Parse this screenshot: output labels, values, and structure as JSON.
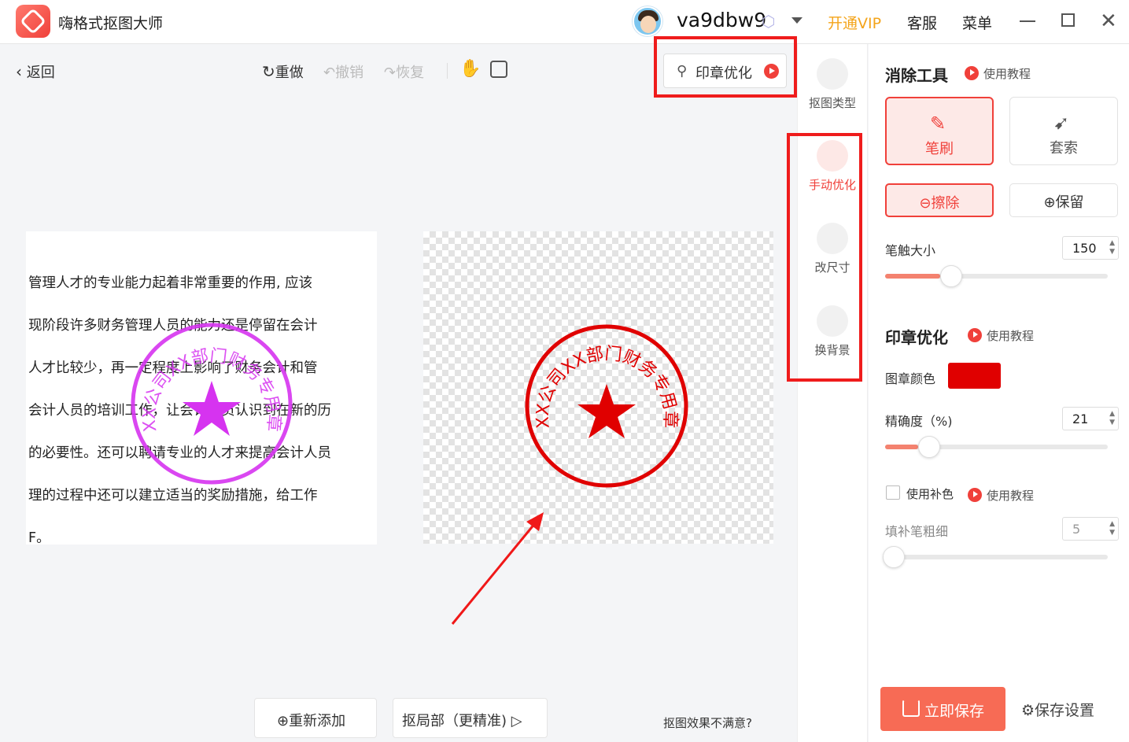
{
  "app": {
    "name": "嗨格式抠图大师"
  },
  "account": {
    "username": "va9dbw9"
  },
  "topnav": {
    "vip": "开通VIP",
    "service": "客服",
    "menu": "菜单"
  },
  "toolbar": {
    "back": "返回",
    "redo": "重做",
    "undo": "撤销",
    "restore": "恢复",
    "stamp_opt": "印章优化"
  },
  "side_tools": [
    {
      "label": "抠图类型"
    },
    {
      "label": "手动优化"
    },
    {
      "label": "改尺寸"
    },
    {
      "label": "换背景"
    }
  ],
  "document": {
    "lines": [
      "管理人才的专业能力起着非常重要的作用, 应该",
      "现阶段许多财务管理人员的能力还是停留在会计",
      "人才比较少，再一定程度上影响了财务会计和管",
      "会计人员的培训工作，让会计人员认识到在新的历",
      "的必要性。还可以聘请专业的人才来提高会计人员",
      "理的过程中还可以建立适当的奖励措施，给工作",
      "F。"
    ]
  },
  "stamp": {
    "text": "XX公司XX部门财务专用章",
    "original_color": "#d633f0",
    "result_color": "#e00000"
  },
  "panel": {
    "erase_title": "消除工具",
    "tutorial": "使用教程",
    "brush": "笔刷",
    "lasso": "套索",
    "erase": "擦除",
    "keep": "保留",
    "brush_size_label": "笔触大小",
    "brush_size": "150",
    "brush_size_fraction": 0.25,
    "stamp_title": "印章优化",
    "stamp_color_label": "图章颜色",
    "stamp_color": "#e00000",
    "precision_label": "精确度（%)",
    "precision": "21",
    "precision_fraction": 0.2,
    "fill_color_label": "使用补色",
    "fill_brush_label": "填补笔粗细",
    "fill_brush": "5",
    "fill_brush_fraction": 0.0,
    "save_now": "立即保存",
    "save_settings": "保存设置"
  },
  "bottom": {
    "readd": "重新添加",
    "partial": "抠局部（更精准)",
    "unsatisfied": "抠图效果不满意?"
  },
  "colors": {
    "accent": "#f0403a",
    "highlight_box": "#ef1c1c",
    "vip": "#f4a41a"
  }
}
